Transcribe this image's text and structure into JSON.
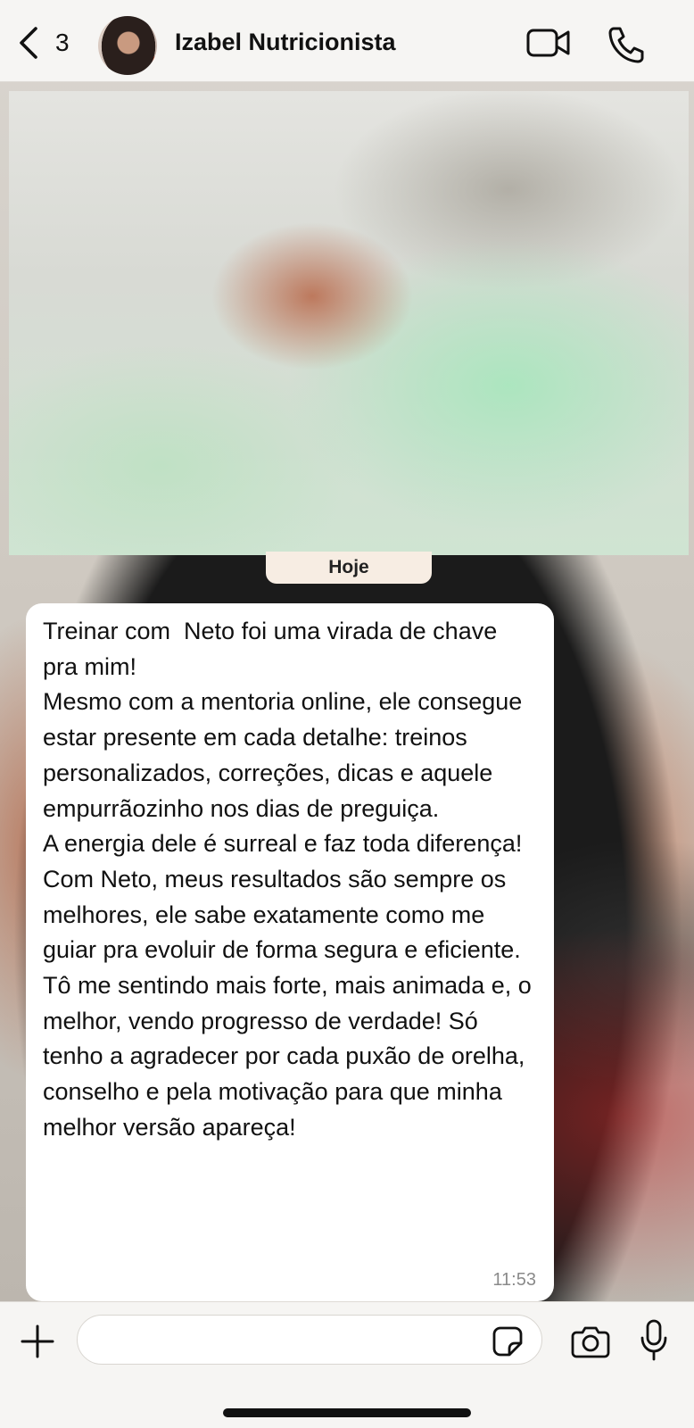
{
  "header": {
    "back_count": "3",
    "contact_name": "Izabel Nutricionista",
    "icons": [
      "chevron-left-icon",
      "video-call-icon",
      "phone-icon"
    ]
  },
  "chat": {
    "date_separator": "Hoje",
    "message": {
      "text": "Treinar com  Neto foi uma virada de chave pra mim!\nMesmo com a mentoria online, ele consegue estar presente em cada detalhe: treinos personalizados, correções, dicas e aquele empurrãozinho nos dias de preguiça.\nA energia dele é surreal e faz toda diferença!\nCom Neto, meus resultados são sempre os melhores, ele sabe exatamente como me guiar pra evoluir de forma segura e eficiente.\nTô me sentindo mais forte, mais animada e, o melhor, vendo progresso de verdade! Só tenho a agradecer por cada puxão de orelha, conselho e pela motivação para que minha melhor versão apareça!",
      "time": "11:53"
    }
  },
  "composer": {
    "input_value": "",
    "icons": [
      "plus-icon",
      "sticker-icon",
      "camera-icon",
      "microphone-icon"
    ]
  },
  "colors": {
    "header_bg": "#f6f5f3",
    "bubble_bg": "#ffffff",
    "date_pill_bg": "#f7ede3",
    "text": "#111111",
    "timestamp": "#8a8a8a"
  }
}
